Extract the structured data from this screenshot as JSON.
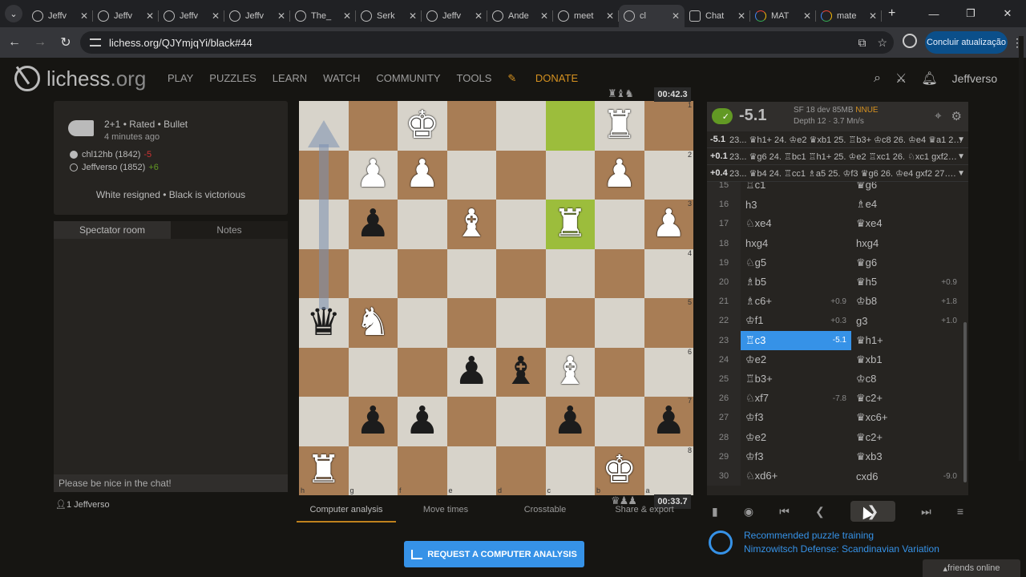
{
  "browser": {
    "tabs": [
      {
        "label": "Jeffv",
        "icon": "lichess"
      },
      {
        "label": "Jeffv",
        "icon": "lichess"
      },
      {
        "label": "Jeffv",
        "icon": "lichess"
      },
      {
        "label": "Jeffv",
        "icon": "lichess"
      },
      {
        "label": "The_",
        "icon": "lichess"
      },
      {
        "label": "Serk",
        "icon": "lichess"
      },
      {
        "label": "Jeffv",
        "icon": "lichess"
      },
      {
        "label": "Ande",
        "icon": "lichess"
      },
      {
        "label": "meet",
        "icon": "lichess"
      },
      {
        "label": "cl",
        "icon": "lichess",
        "active": true
      },
      {
        "label": "Chat",
        "icon": "chatgpt"
      },
      {
        "label": "MAT",
        "icon": "google"
      },
      {
        "label": "mate",
        "icon": "google"
      }
    ],
    "url": "lichess.org/QJYmjqYi/black#44",
    "update_label": "Concluir atualização"
  },
  "header": {
    "logo_main": "lichess",
    "logo_tld": ".org",
    "nav": [
      "PLAY",
      "PUZZLES",
      "LEARN",
      "WATCH",
      "COMMUNITY",
      "TOOLS"
    ],
    "donate": "DONATE",
    "username": "Jeffverso"
  },
  "game_info": {
    "type": "2+1 • Rated • Bullet",
    "time_ago": "4 minutes ago",
    "players": [
      {
        "name": "chl12hb (1842)",
        "diff": "-5",
        "color": "white"
      },
      {
        "name": "Jeffverso (1852)",
        "diff": "+6",
        "color": "black"
      }
    ],
    "result": "White resigned • Black is victorious"
  },
  "chat": {
    "tabs": [
      "Spectator room",
      "Notes"
    ],
    "placeholder": "Please be nice in the chat!",
    "spectators": "1  Jeffverso"
  },
  "board": {
    "top_clock": "00:42.3",
    "bottom_clock": "00:33.7",
    "top_material": "♜♝♞",
    "bottom_material": "♛♟♟",
    "ranks": [
      "1",
      "2",
      "3",
      "4",
      "5",
      "6",
      "7",
      "8"
    ],
    "files": [
      "h",
      "g",
      "f",
      "e",
      "d",
      "c",
      "b",
      "a"
    ],
    "squares": [
      [
        "",
        "",
        "♚w",
        "",
        "",
        "",
        "♜w",
        ""
      ],
      [
        "",
        "♟w",
        "♟w",
        "",
        "",
        "",
        "♟w",
        ""
      ],
      [
        "",
        "♟b",
        "",
        "♝w",
        "",
        "♜w",
        "",
        "♟w"
      ],
      [
        "",
        "",
        "",
        "",
        "",
        "",
        "",
        ""
      ],
      [
        "♛b",
        "♞w",
        "",
        "",
        "",
        "",
        "",
        ""
      ],
      [
        "",
        "",
        "",
        "♟b",
        "♝b",
        "♝w",
        "",
        ""
      ],
      [
        "",
        "♟b",
        "♟b",
        "",
        "",
        "♟b",
        "",
        "♟b"
      ],
      [
        "♜w",
        "",
        "",
        "",
        "",
        "",
        "♚w",
        ""
      ]
    ]
  },
  "board_tabs": [
    "Computer analysis",
    "Move times",
    "Crosstable",
    "Share & export"
  ],
  "request_analysis": "REQUEST A COMPUTER ANALYSIS",
  "ceval": {
    "score": "-5.1",
    "engine": "SF 18 dev 85MB",
    "nnue": "NNUE",
    "depth": "Depth 12 · 3.7 Mn/s"
  },
  "pvs": [
    {
      "eval": "-5.1",
      "line": "23... ♛h1+ 24. ♔e2 ♛xb1 25. ♖b3+ ♔c8 26. ♔e4 ♛a1 2…"
    },
    {
      "eval": "+0.1",
      "line": "23... ♛g6 24. ♖bc1 ♖h1+ 25. ♔e2 ♖xc1 26. ♘xc1 gxf2…"
    },
    {
      "eval": "+0.4",
      "line": "23... ♛b4 24. ♖cc1 ♗a5 25. ♔f3 ♛g6 26. ♔e4 gxf2 27…."
    }
  ],
  "moves": [
    {
      "n": "15",
      "w": "♖c1",
      "we": "",
      "b": "♛g6",
      "be": ""
    },
    {
      "n": "16",
      "w": "h3",
      "we": "",
      "b": "♗e4",
      "be": ""
    },
    {
      "n": "17",
      "w": "♘xe4",
      "we": "",
      "b": "♛xe4",
      "be": ""
    },
    {
      "n": "18",
      "w": "hxg4",
      "we": "",
      "b": "hxg4",
      "be": ""
    },
    {
      "n": "19",
      "w": "♘g5",
      "we": "",
      "b": "♛g6",
      "be": ""
    },
    {
      "n": "20",
      "w": "♗b5",
      "we": "",
      "b": "♛h5",
      "be": "+0.9"
    },
    {
      "n": "21",
      "w": "♗c6+",
      "we": "+0.9",
      "b": "♔b8",
      "be": "+1.8"
    },
    {
      "n": "22",
      "w": "♔f1",
      "we": "+0.3",
      "b": "g3",
      "be": "+1.0"
    },
    {
      "n": "23",
      "w": "♖c3",
      "we": "-5.1",
      "b": "♛h1+",
      "be": "",
      "current": true
    },
    {
      "n": "24",
      "w": "♔e2",
      "we": "",
      "b": "♛xb1",
      "be": ""
    },
    {
      "n": "25",
      "w": "♖b3+",
      "we": "",
      "b": "♔c8",
      "be": ""
    },
    {
      "n": "26",
      "w": "♘xf7",
      "we": "-7.8",
      "b": "♛c2+",
      "be": ""
    },
    {
      "n": "27",
      "w": "♔f3",
      "we": "",
      "b": "♛xc6+",
      "be": ""
    },
    {
      "n": "28",
      "w": "♔e2",
      "we": "",
      "b": "♛c2+",
      "be": ""
    },
    {
      "n": "29",
      "w": "♔f3",
      "we": "",
      "b": "♛xb3",
      "be": ""
    },
    {
      "n": "30",
      "w": "♘xd6+",
      "we": "",
      "b": "cxd6",
      "be": "-9.0"
    }
  ],
  "training": {
    "title": "Recommended puzzle training",
    "subtitle": "Nimzowitsch Defense: Scandinavian Variation"
  },
  "friends": "friends online"
}
